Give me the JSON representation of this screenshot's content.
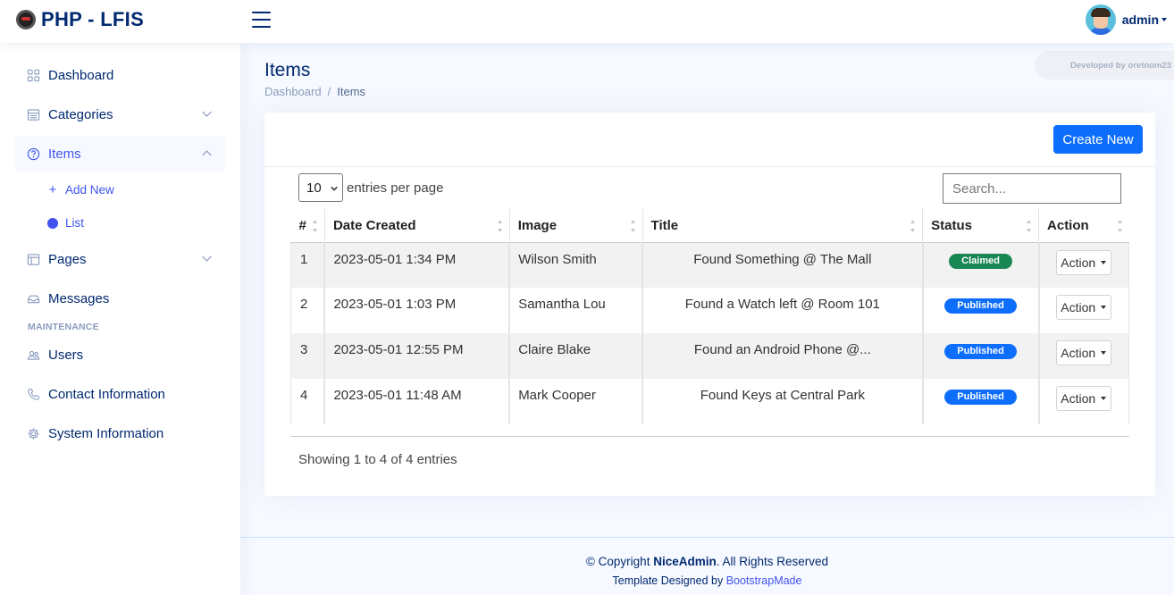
{
  "header": {
    "app_title": "PHP - LFIS",
    "user_name": "admin"
  },
  "sidebar": {
    "items": [
      {
        "label": "Dashboard",
        "icon": "grid-icon"
      },
      {
        "label": "Categories",
        "icon": "list-icon"
      },
      {
        "label": "Items",
        "icon": "question-circle-icon"
      },
      {
        "label": "Pages",
        "icon": "layout-icon"
      },
      {
        "label": "Messages",
        "icon": "inbox-icon"
      }
    ],
    "items_sub": [
      {
        "label": "Add New"
      },
      {
        "label": "List"
      }
    ],
    "maintenance_heading": "MAINTENANCE",
    "maintenance_items": [
      {
        "label": "Users",
        "icon": "people-icon"
      },
      {
        "label": "Contact Information",
        "icon": "phone-icon"
      },
      {
        "label": "System Information",
        "icon": "gear-icon"
      }
    ]
  },
  "main": {
    "page_title": "Items",
    "breadcrumb": [
      "Dashboard",
      "Items"
    ],
    "breadcrumb_sep": "/",
    "dev_badge": "Developed by oretnom23",
    "create_button": "Create New",
    "entries_value": "10",
    "entries_label": "entries per page",
    "search_placeholder": "Search...",
    "columns": [
      "#",
      "Date Created",
      "Image",
      "Title",
      "Status",
      "Action"
    ],
    "rows": [
      {
        "num": "1",
        "date": "2023-05-01 1:34 PM",
        "image": "Wilson Smith",
        "title": "Found Something @ The Mall",
        "status": "Claimed",
        "action": "Action"
      },
      {
        "num": "2",
        "date": "2023-05-01 1:03 PM",
        "image": "Samantha Lou",
        "title": "Found a Watch left @ Room 101",
        "status": "Published",
        "action": "Action"
      },
      {
        "num": "3",
        "date": "2023-05-01 12:55 PM",
        "image": "Claire Blake",
        "title": "Found an Android Phone @...",
        "status": "Published",
        "action": "Action"
      },
      {
        "num": "4",
        "date": "2023-05-01 11:48 AM",
        "image": "Mark Cooper",
        "title": "Found Keys at Central Park",
        "status": "Published",
        "action": "Action"
      }
    ],
    "info": "Showing 1 to 4 of 4 entries"
  },
  "footer": {
    "copyright_prefix": "© Copyright ",
    "brand": "NiceAdmin",
    "copyright_suffix": ". All Rights Reserved",
    "designed_by": "Template Designed by ",
    "designer": "BootstrapMade"
  },
  "colors": {
    "primary": "#4154f1",
    "navy": "#012970",
    "button_blue": "#0d6efd",
    "claimed_green": "#198754"
  }
}
